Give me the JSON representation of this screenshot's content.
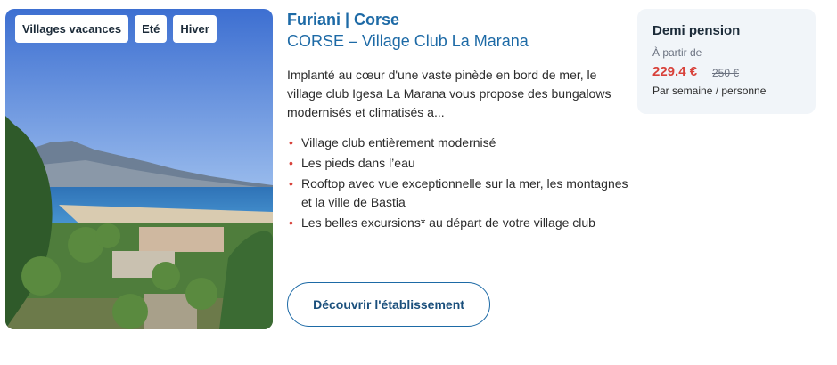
{
  "tags": [
    "Villages vacances",
    "Eté",
    "Hiver"
  ],
  "location": "Furiani | Corse",
  "hotel_name": "CORSE – Village Club La Marana",
  "description": "Implanté au cœur d'une vaste pinède en bord de mer, le village club Igesa La Marana vous propose des bungalows modernisés et climatisés a...",
  "features": [
    "Village club entièrement modernisé",
    "Les pieds dans l’eau",
    "Rooftop avec vue exceptionnelle sur la mer, les montagnes et la ville de Bastia",
    "Les belles excursions* au départ de votre village club"
  ],
  "cta_label": "Découvrir l'établissement",
  "price": {
    "board": "Demi pension",
    "from_label": "À partir de",
    "amount": "229.4 €",
    "old_amount": "250 €",
    "per": "Par semaine / personne"
  },
  "colors": {
    "accent": "#1d6aa6",
    "price": "#d8413a",
    "panel": "#f1f5f9"
  }
}
